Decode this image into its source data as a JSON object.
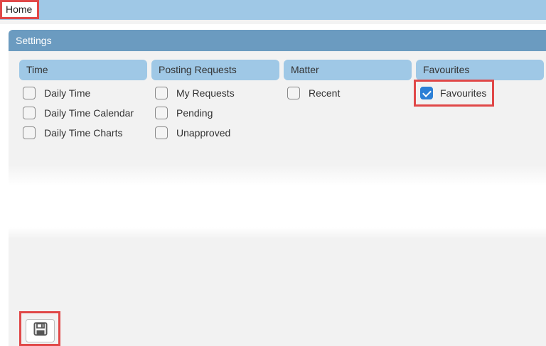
{
  "topbar": {
    "home_label": "Home"
  },
  "panel": {
    "title": "Settings"
  },
  "columns": [
    {
      "header": "Time",
      "items": [
        {
          "label": "Daily Time",
          "checked": false
        },
        {
          "label": "Daily Time Calendar",
          "checked": false
        },
        {
          "label": "Daily Time Charts",
          "checked": false
        }
      ]
    },
    {
      "header": "Posting Requests",
      "items": [
        {
          "label": "My Requests",
          "checked": false
        },
        {
          "label": "Pending",
          "checked": false
        },
        {
          "label": "Unapproved",
          "checked": false
        }
      ]
    },
    {
      "header": "Matter",
      "items": [
        {
          "label": "Recent",
          "checked": false
        }
      ]
    },
    {
      "header": "Favourites",
      "items": [
        {
          "label": "Favourites",
          "checked": true
        }
      ]
    }
  ],
  "save": {
    "icon": "floppy-disk-icon"
  },
  "colors": {
    "header_blue": "#9fc8e6",
    "panel_header": "#6b9bc0",
    "highlight": "#e04848",
    "checkbox_checked": "#2b7fd6"
  }
}
